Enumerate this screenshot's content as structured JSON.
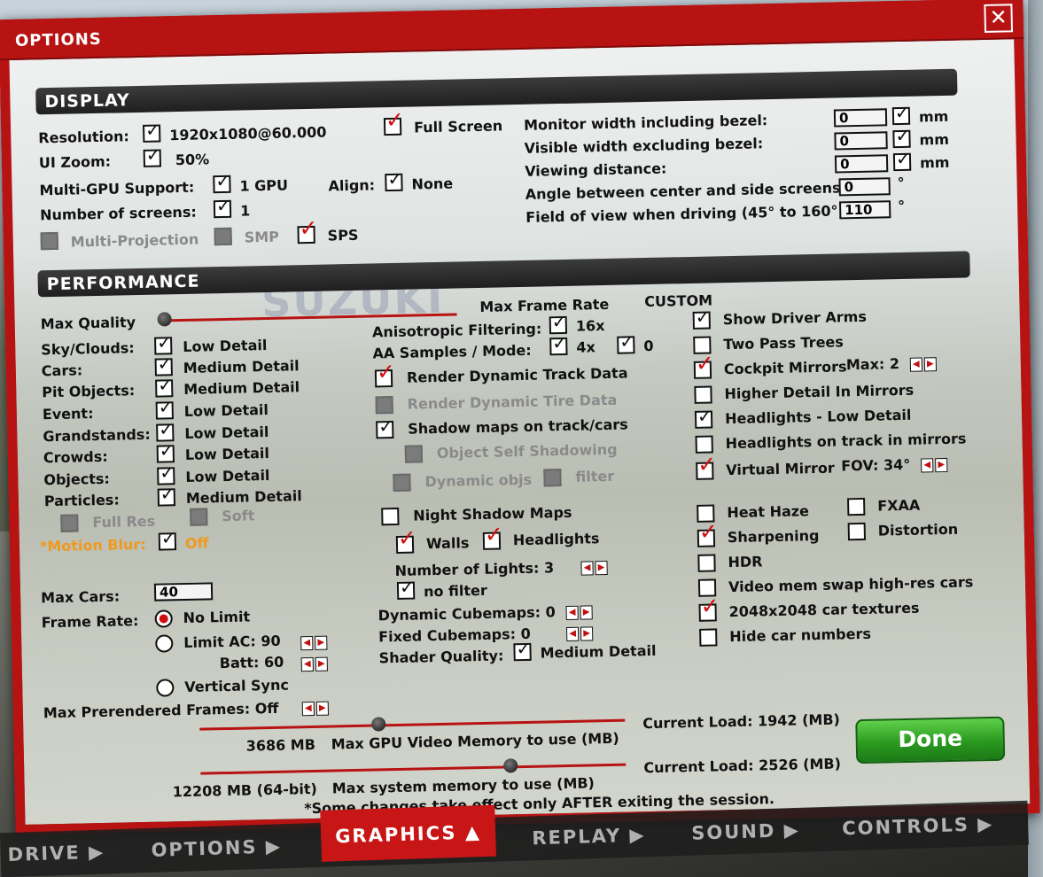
{
  "window": {
    "title": "OPTIONS",
    "close_icon": "close-x-icon"
  },
  "display": {
    "header": "DISPLAY",
    "resolution_label": "Resolution:",
    "resolution_value": "1920x1080@60.000",
    "full_screen_label": "Full Screen",
    "ui_zoom_label": "UI Zoom:",
    "ui_zoom_value": "50%",
    "multi_gpu_label": "Multi-GPU Support:",
    "multi_gpu_value": "1 GPU",
    "screens_label": "Number of screens:",
    "screens_value": "1",
    "align_label": "Align:",
    "align_value": "None",
    "multi_projection_label": "Multi-Projection",
    "smp_label": "SMP",
    "sps_label": "SPS",
    "monitor_width_label": "Monitor width including bezel:",
    "monitor_width_value": "0",
    "monitor_width_unit": "mm",
    "visible_width_label": "Visible width excluding bezel:",
    "visible_width_value": "0",
    "visible_width_unit": "mm",
    "viewing_distance_label": "Viewing distance:",
    "viewing_distance_value": "0",
    "viewing_distance_unit": "mm",
    "angle_label": "Angle between center and side screens:",
    "angle_value": "0",
    "angle_unit": "°",
    "fov_label": "Field of view when driving (45° to 160°):",
    "fov_value": "110",
    "fov_unit": "°"
  },
  "performance": {
    "header": "PERFORMANCE",
    "max_quality_label": "Max Quality",
    "max_frame_rate_label": "Max Frame Rate",
    "preset_value": "CUSTOM",
    "quality_rows": [
      {
        "label": "Sky/Clouds:",
        "value": "Low Detail"
      },
      {
        "label": "Cars:",
        "value": "Medium Detail"
      },
      {
        "label": "Pit Objects:",
        "value": "Medium Detail"
      },
      {
        "label": "Event:",
        "value": "Low Detail"
      },
      {
        "label": "Grandstands:",
        "value": "Low Detail"
      },
      {
        "label": "Crowds:",
        "value": "Low Detail"
      },
      {
        "label": "Objects:",
        "value": "Low Detail"
      },
      {
        "label": "Particles:",
        "value": "Medium Detail"
      }
    ],
    "full_res_label": "Full Res",
    "soft_label": "Soft",
    "motion_blur_label": "*Motion Blur:",
    "motion_blur_value": "Off",
    "max_cars_label": "Max Cars:",
    "max_cars_value": "40",
    "frame_rate_label": "Frame Rate:",
    "no_limit_label": "No Limit",
    "limit_ac_label": "Limit AC: 90",
    "batt_label": "Batt: 60",
    "vsync_label": "Vertical Sync",
    "prerendered_label": "Max Prerendered Frames: Off",
    "anisotropic_label": "Anisotropic Filtering:",
    "anisotropic_value": "16x",
    "aa_label": "AA Samples / Mode:",
    "aa_value": "4x",
    "aa_mode_value": "0",
    "render_track_label": "Render Dynamic Track Data",
    "render_tire_label": "Render Dynamic Tire Data",
    "shadow_maps_label": "Shadow maps on track/cars",
    "self_shadow_label": "Object Self Shadowing",
    "dynamic_objs_label": "Dynamic objs",
    "filter_label": "filter",
    "night_shadow_label": "Night Shadow Maps",
    "walls_label": "Walls",
    "headlights_label": "Headlights",
    "num_lights_label": "Number of Lights: 3",
    "no_filter_label": "no filter",
    "dyn_cubemaps_label": "Dynamic Cubemaps: 0",
    "fixed_cubemaps_label": "Fixed Cubemaps: 0",
    "shader_quality_label": "Shader Quality:",
    "shader_quality_value": "Medium Detail",
    "right_options": {
      "show_driver_arms": "Show Driver Arms",
      "two_pass_trees": "Two Pass Trees",
      "cockpit_mirrors": "Cockpit Mirrors",
      "mirrors_max": "Max:  2",
      "higher_detail_mirrors": "Higher Detail In Mirrors",
      "headlights_low": "Headlights - Low Detail",
      "headlights_track_mirrors": "Headlights on track in mirrors",
      "virtual_mirror": "Virtual Mirror",
      "virtual_fov": "FOV:  34°",
      "heat_haze": "Heat Haze",
      "fxaa": "FXAA",
      "sharpening": "Sharpening",
      "distortion": "Distortion",
      "hdr": "HDR",
      "video_mem_swap": "Video mem swap high-res cars",
      "car_textures": "2048x2048 car textures",
      "hide_car_numbers": "Hide car numbers"
    },
    "gpu_mem_value": "3686 MB",
    "gpu_mem_label": "Max GPU Video Memory to use (MB)",
    "gpu_load": "Current Load: 1942 (MB)",
    "gpu_mem_fraction": 0.42,
    "sys_mem_value": "12208 MB (64-bit)",
    "sys_mem_label": "Max system memory to use (MB)",
    "sys_load": "Current Load: 2526 (MB)",
    "sys_mem_fraction": 0.73,
    "max_quality_fraction": 0.0,
    "note": "*Some changes take effect only AFTER exiting the session.",
    "done_label": "Done"
  },
  "tabs": [
    "DRIVE",
    "OPTIONS",
    "GRAPHICS",
    "REPLAY",
    "SOUND",
    "CONTROLS"
  ],
  "active_tab": "GRAPHICS",
  "colors": {
    "accent": "#b81313",
    "done": "#2a9a20",
    "motion_blur": "#ee9a1f"
  }
}
